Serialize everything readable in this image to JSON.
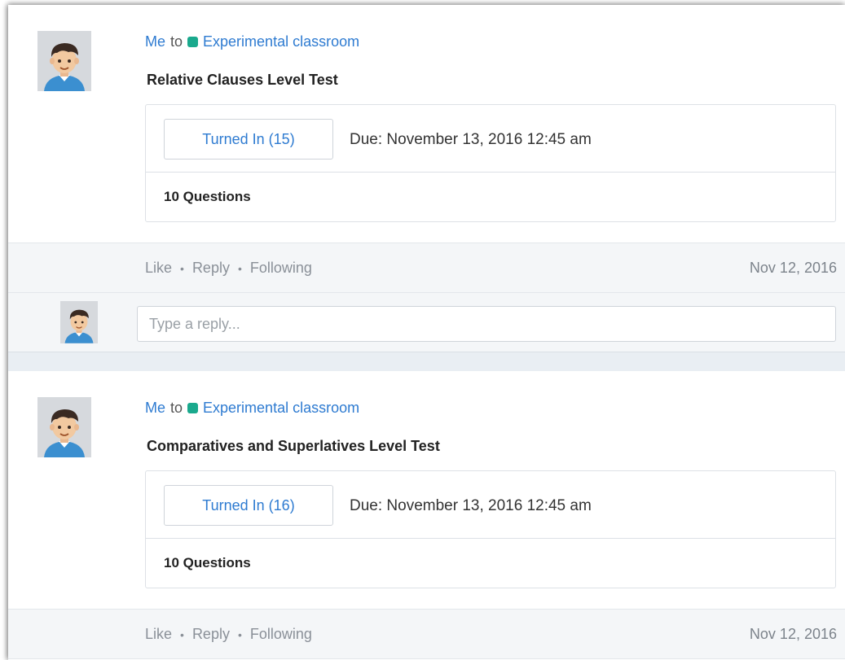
{
  "posts": [
    {
      "sender": "Me",
      "to_word": "to",
      "classroom": "Experimental classroom",
      "title": "Relative Clauses Level Test",
      "turned_in_label": "Turned In (15)",
      "due": "Due: November 13, 2016 12:45 am",
      "questions": "10 Questions",
      "actions": {
        "like": "Like",
        "reply": "Reply",
        "following": "Following",
        "separator": "•"
      },
      "date": "Nov 12, 2016",
      "reply_placeholder": "Type a reply..."
    },
    {
      "sender": "Me",
      "to_word": "to",
      "classroom": "Experimental classroom",
      "title": "Comparatives and Superlatives Level Test",
      "turned_in_label": "Turned In (16)",
      "due": "Due: November 13, 2016 12:45 am",
      "questions": "10 Questions",
      "actions": {
        "like": "Like",
        "reply": "Reply",
        "following": "Following",
        "separator": "•"
      },
      "date": "Nov 12, 2016"
    }
  ],
  "colors": {
    "link": "#2e7bd1",
    "classroom_dot": "#1aa98d",
    "action_bg": "#f4f6f8"
  },
  "icons": {
    "avatar": "boy-avatar-icon"
  }
}
